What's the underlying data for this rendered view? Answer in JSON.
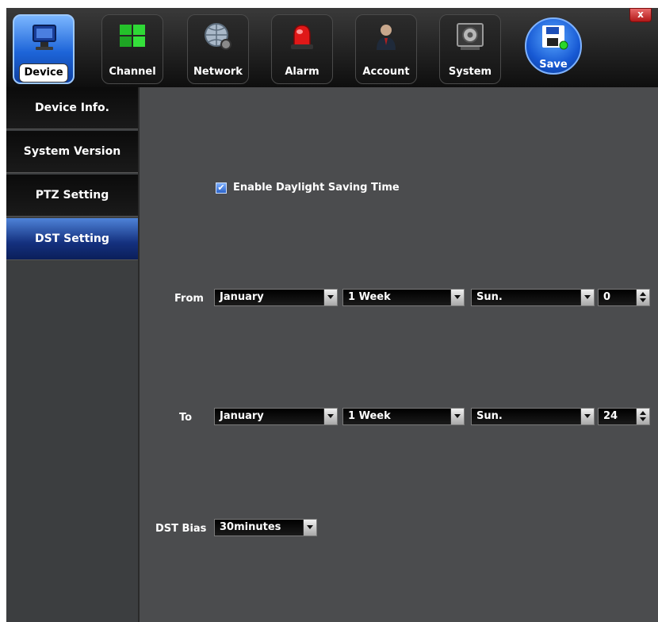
{
  "toolbar": {
    "tabs": [
      {
        "label": "Device",
        "icon": "monitor-icon"
      },
      {
        "label": "Channel",
        "icon": "grid-icon"
      },
      {
        "label": "Network",
        "icon": "globe-gear-icon"
      },
      {
        "label": "Alarm",
        "icon": "siren-icon"
      },
      {
        "label": "Account",
        "icon": "user-icon"
      },
      {
        "label": "System",
        "icon": "gear-icon"
      },
      {
        "label": "Save",
        "icon": "floppy-disk-icon"
      }
    ],
    "close_label": "x"
  },
  "sidebar": {
    "items": [
      {
        "label": "Device Info."
      },
      {
        "label": "System Version"
      },
      {
        "label": "PTZ Setting"
      },
      {
        "label": "DST Setting"
      }
    ],
    "active": "DST Setting"
  },
  "dst": {
    "enable_label": "Enable Daylight Saving Time",
    "enabled": true,
    "from": {
      "label": "From",
      "month": "January",
      "week": "1 Week",
      "day": "Sun.",
      "hour": "0"
    },
    "to": {
      "label": "To",
      "month": "January",
      "week": "1 Week",
      "day": "Sun.",
      "hour": "24"
    },
    "bias": {
      "label": "DST Bias",
      "value": "30minutes"
    }
  },
  "colors": {
    "accent": "#1d64d8",
    "panel": "#4b4c4e",
    "sidebar_active": "#14307e"
  }
}
